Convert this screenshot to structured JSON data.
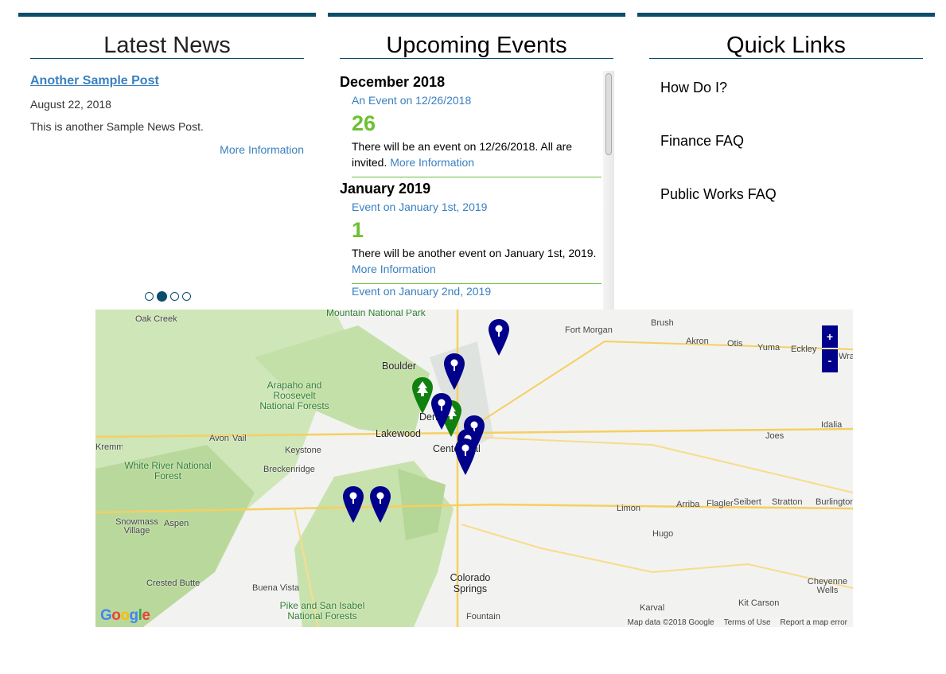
{
  "news": {
    "heading": "Latest News",
    "post_title": "Another Sample Post",
    "post_date": "August 22, 2018",
    "post_text": "This is another Sample News Post.",
    "more_label": "More Information",
    "carousel": {
      "pages": 4,
      "active": 2
    }
  },
  "events": {
    "heading": "Upcoming Events",
    "months": [
      {
        "label": "December 2018",
        "items": [
          {
            "title": "An Event on 12/26/2018",
            "day": "26",
            "text": "There will be an event on 12/26/2018.  All are invited.",
            "more": "More Information"
          }
        ]
      },
      {
        "label": "January 2019",
        "items": [
          {
            "title": "Event on January 1st, 2019",
            "day": "1",
            "text": "There will be another event on January 1st, 2019.",
            "more": "More Information"
          },
          {
            "title": "Event on January 2nd, 2019"
          }
        ]
      }
    ]
  },
  "links": {
    "heading": "Quick Links",
    "items": [
      "How Do I?",
      "Finance FAQ",
      "Public Works FAQ"
    ]
  },
  "map": {
    "zoom_in": "+",
    "zoom_out": "-",
    "logo": "Google",
    "attribution": [
      "Map data ©2018 Google",
      "Terms of Use",
      "Report a map error"
    ],
    "pin_colors": {
      "event": "#00008b",
      "park": "#108010"
    },
    "places": [
      "Oak Creek",
      "Mountain National Park",
      "Fort Morgan",
      "Brush",
      "Akron",
      "Otis",
      "Yuma",
      "Eckley",
      "Wray",
      "Boulder",
      "Arapaho and Roosevelt National Forests",
      "Denver",
      "Lakewood",
      "Centennial",
      "Avon",
      "Vail",
      "Keystone",
      "Breckenridge",
      "White River National Forest",
      "Snowmass Village",
      "Aspen",
      "Joes",
      "Idalia",
      "Limon",
      "Arriba",
      "Flagler",
      "Seibert",
      "Stratton",
      "Burlington",
      "Hugo",
      "Colorado Springs",
      "Buena Vista",
      "Crested Butte",
      "Pike and San Isabel National Forests",
      "Fountain",
      "Karval",
      "Kit Carson",
      "Cheyenne Wells",
      "Kremmling"
    ]
  }
}
